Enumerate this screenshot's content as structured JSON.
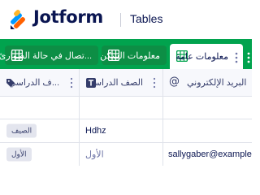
{
  "header": {
    "logo_text": "Jotform",
    "product": "Tables"
  },
  "tabs": [
    {
      "label": "...تصال في حالة الطوارئ",
      "active": false
    },
    {
      "label": "معلومات السكن",
      "active": false
    },
    {
      "label": "معلومات عامة",
      "active": true
    }
  ],
  "columns": [
    {
      "label": "...ف الدراسي",
      "icon": "tag-icon"
    },
    {
      "label": "الصف الدراسي",
      "icon": "text-type-icon"
    },
    {
      "label": "البريد الإلكتروني",
      "icon": "at-sign-icon"
    }
  ],
  "rows": [
    {
      "semester": "",
      "grade": "",
      "email": ""
    },
    {
      "semester": "الصيف",
      "grade": "Hdhz",
      "email": ""
    },
    {
      "semester": "الأول",
      "grade": "الأول",
      "email": "sallygaber@example.c"
    }
  ],
  "colors": {
    "tabbar": "#01a34e",
    "tab_inactive": "#0d8e45",
    "brand_navy": "#0a1551",
    "logo_orange": "#ff6100",
    "logo_blue": "#0099ff",
    "logo_yellow": "#ffb629"
  }
}
